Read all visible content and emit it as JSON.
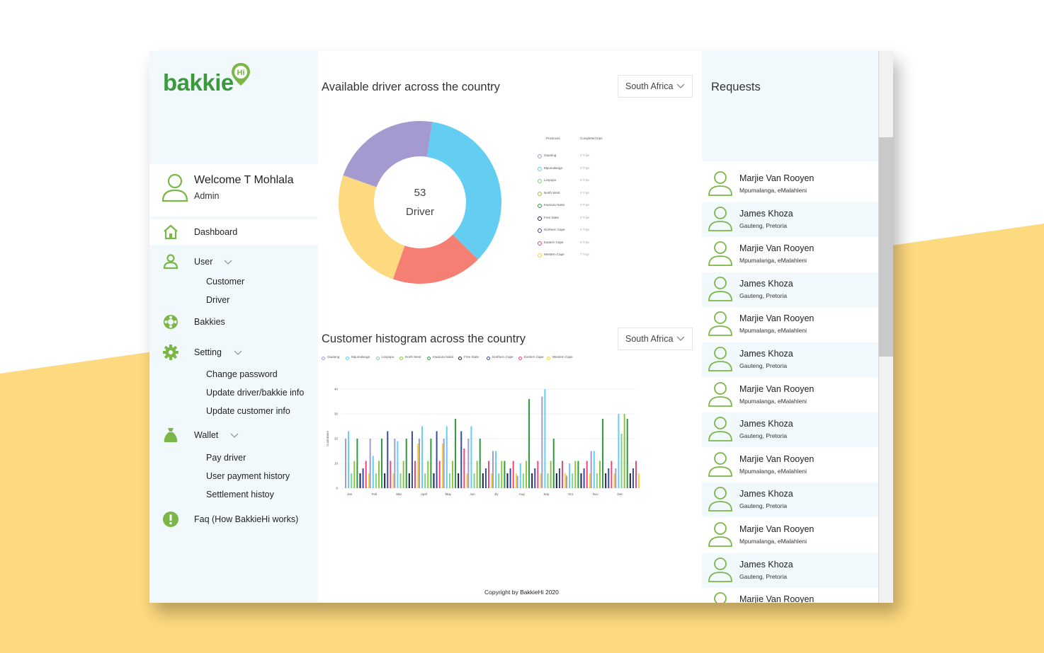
{
  "brand": {
    "logo_text": "bakkie",
    "logo_badge": "Hi"
  },
  "colors": {
    "accent_green": "#7ab648",
    "background_yellow": "#fdd97f",
    "panel_bg": "#f2f9fc"
  },
  "user": {
    "welcome": "Welcome T Mohlala",
    "role": "Admin"
  },
  "menu": {
    "dashboard": "Dashboard",
    "user": "User",
    "user_sub": [
      "Customer",
      "Driver"
    ],
    "bakkies": "Bakkies",
    "setting": "Setting",
    "setting_sub": [
      "Change password",
      "Update driver/bakkie info",
      "Update customer info"
    ],
    "wallet": "Wallet",
    "wallet_sub": [
      "Pay driver",
      "User payment history",
      "Settlement histoy"
    ],
    "faq": "Faq (How BakkieHi works)"
  },
  "drivers_section": {
    "title": "Available driver across the country",
    "dropdown": "South Africa",
    "donut_value": "53",
    "donut_label": "Driver",
    "legend_header_left": "Provinces",
    "legend_header_right": "Completed trips",
    "legend": [
      {
        "name": "Gauteng",
        "value": "0 Trips",
        "color": "#a59ad0"
      },
      {
        "name": "Mpumalanga",
        "value": "5 Trips",
        "color": "#63cef2"
      },
      {
        "name": "Limpopo",
        "value": "0 Trips",
        "color": "#7fd38c"
      },
      {
        "name": "North West",
        "value": "0 Trips",
        "color": "#8cc63f"
      },
      {
        "name": "Kwazulu Natal",
        "value": "0 Trips",
        "color": "#2e9a3e"
      },
      {
        "name": "Free State",
        "value": "0 Trips",
        "color": "#1b1f4b"
      },
      {
        "name": "Northern Cape",
        "value": "0 Trips",
        "color": "#3b4aa0"
      },
      {
        "name": "Eastern Cape",
        "value": "0 Trips",
        "color": "#e84a7a"
      },
      {
        "name": "Western Cape",
        "value": "7 Trips",
        "color": "#f5d23c"
      }
    ]
  },
  "chart_data": [
    {
      "type": "pie",
      "title": "Available driver across the country",
      "center_text": [
        "53",
        "Driver"
      ],
      "categories": [
        "Mpumalanga",
        "Eastern Cape",
        "Western Cape",
        "Gauteng"
      ],
      "values": [
        35,
        18,
        25,
        22
      ],
      "colors": [
        "#63cef2",
        "#f47f72",
        "#fdd97f",
        "#a59ad0"
      ]
    },
    {
      "type": "bar",
      "title": "Customer histogram across the country",
      "ylabel": "Customers",
      "ylim": [
        0,
        40
      ],
      "yticks": [
        0,
        10,
        20,
        30,
        40
      ],
      "categories": [
        "Jan",
        "Feb",
        "Mar",
        "April",
        "May",
        "Jun",
        "Jly",
        "Aug",
        "Sep",
        "Oct",
        "Nov",
        "Dec"
      ],
      "series": [
        {
          "name": "Gauteng",
          "color": "#a59ad0",
          "values": [
            20,
            20,
            20,
            20,
            20,
            20,
            15,
            5,
            37,
            5,
            15,
            8
          ]
        },
        {
          "name": "Mpumalanga",
          "color": "#63cef2",
          "values": [
            23,
            13,
            19,
            25,
            25,
            25,
            15,
            10,
            40,
            10,
            15,
            30
          ]
        },
        {
          "name": "Limpopo",
          "color": "#7fd38c",
          "values": [
            6,
            6,
            6,
            6,
            6,
            6,
            6,
            6,
            6,
            6,
            6,
            22
          ]
        },
        {
          "name": "North West",
          "color": "#8cc63f",
          "values": [
            11,
            11,
            11,
            11,
            11,
            11,
            11,
            11,
            11,
            11,
            11,
            30
          ]
        },
        {
          "name": "Kwazulu Natal",
          "color": "#2e9a3e",
          "values": [
            20,
            20,
            20,
            20,
            28,
            20,
            11,
            36,
            20,
            11,
            28,
            28
          ]
        },
        {
          "name": "Free State",
          "color": "#1b1f4b",
          "values": [
            6,
            6,
            6,
            6,
            6,
            6,
            6,
            6,
            6,
            6,
            6,
            6
          ]
        },
        {
          "name": "Northern Cape",
          "color": "#3b4aa0",
          "values": [
            8,
            23,
            23,
            23,
            23,
            8,
            8,
            8,
            8,
            8,
            8,
            8
          ]
        },
        {
          "name": "Eastern Cape",
          "color": "#e84a7a",
          "values": [
            11,
            11,
            11,
            11,
            16,
            11,
            11,
            11,
            11,
            11,
            11,
            11
          ]
        },
        {
          "name": "Western Cape",
          "color": "#f5d23c",
          "values": [
            6,
            6,
            18,
            18,
            6,
            6,
            6,
            6,
            6,
            6,
            6,
            6
          ]
        }
      ]
    }
  ],
  "histogram_section": {
    "title": "Customer histogram across the country",
    "dropdown": "South Africa"
  },
  "requests": {
    "title": "Requests",
    "items": [
      {
        "name": "Marjie Van Rooyen",
        "location": "Mpumalanga, eMalahleni"
      },
      {
        "name": "James Khoza",
        "location": "Gauteng, Pretoria"
      },
      {
        "name": "Marjie Van Rooyen",
        "location": "Mpumalanga, eMalahleni"
      },
      {
        "name": "James Khoza",
        "location": "Gauteng, Pretoria"
      },
      {
        "name": "Marjie Van Rooyen",
        "location": "Mpumalanga, eMalahleni"
      },
      {
        "name": "James Khoza",
        "location": "Gauteng, Pretoria"
      },
      {
        "name": "Marjie Van Rooyen",
        "location": "Mpumalanga, eMalahleni"
      },
      {
        "name": "James Khoza",
        "location": "Gauteng, Pretoria"
      },
      {
        "name": "Marjie Van Rooyen",
        "location": "Mpumalanga, eMalahleni"
      },
      {
        "name": "James Khoza",
        "location": "Gauteng, Pretoria"
      },
      {
        "name": "Marjie Van Rooyen",
        "location": "Mpumalanga, eMalahleni"
      },
      {
        "name": "James Khoza",
        "location": "Gauteng, Pretoria"
      },
      {
        "name": "Marjie Van Rooyen",
        "location": ""
      }
    ]
  },
  "footer": {
    "copyright": "Copyright by BakkieHi 2020"
  }
}
